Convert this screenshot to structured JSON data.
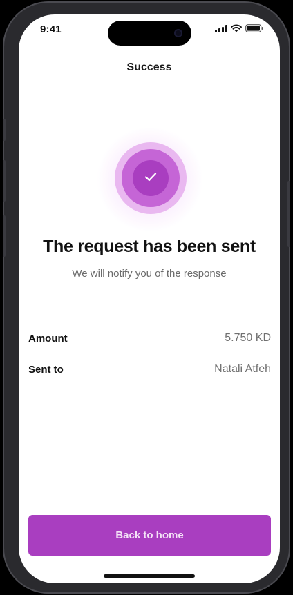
{
  "status_bar": {
    "time": "9:41",
    "icons": [
      "cellular-signal-icon",
      "wifi-icon",
      "battery-icon"
    ]
  },
  "nav": {
    "title": "Success"
  },
  "status_graphic": {
    "icon": "check-icon",
    "colors": {
      "badge": "#a93ec0",
      "ring_middle": "#c565d6",
      "ring_outer": "#e9b8f0"
    }
  },
  "message": {
    "title": "The request has been sent",
    "subtitle": "We will notify you of the response"
  },
  "details": {
    "amount_label": "Amount",
    "amount_value": "5.750 KD",
    "sent_to_label": "Sent to",
    "sent_to_value": "Natali Atfeh"
  },
  "actions": {
    "back_home_label": "Back to home"
  },
  "theme": {
    "accent": "#a93ec0",
    "background": "#ffffff",
    "text_primary": "#111111",
    "text_secondary": "#707070"
  }
}
